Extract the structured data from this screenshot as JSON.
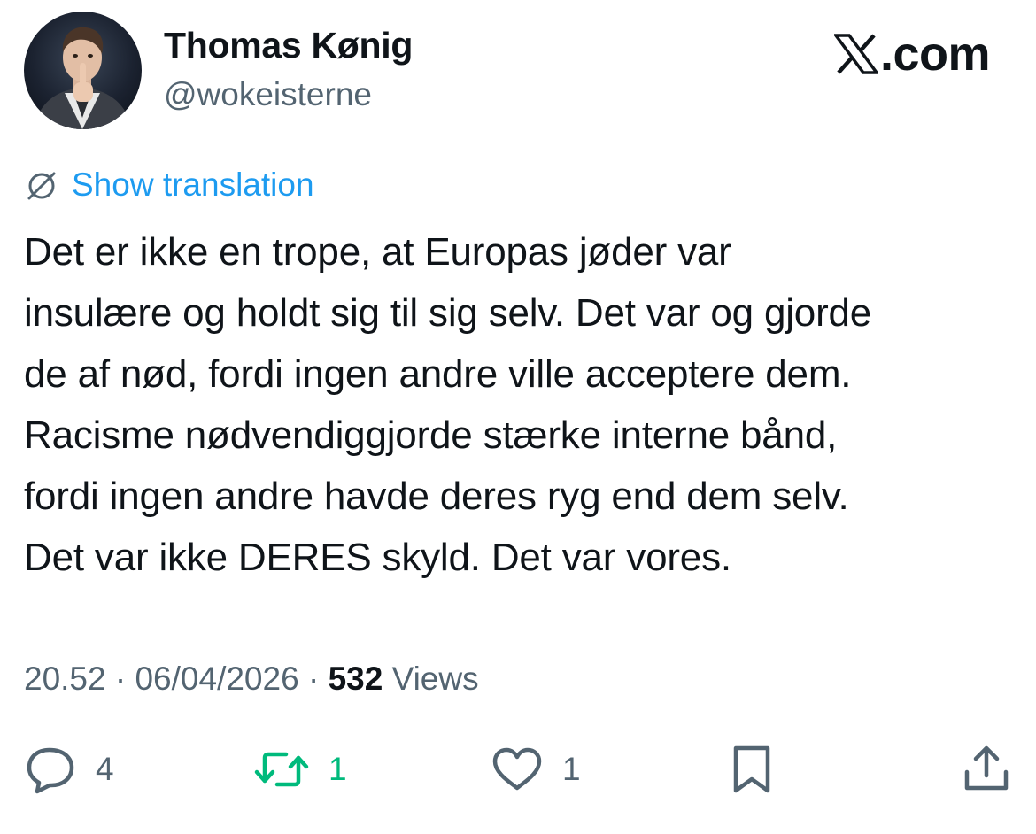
{
  "author": {
    "display_name": "Thomas Kønig",
    "handle": "@wokeisterne",
    "avatar_icon": "profile-photo"
  },
  "brand": {
    "icon": "x-logo-icon",
    "text": ".com"
  },
  "translate": {
    "icon": "globe-icon",
    "label": "Show translation",
    "color": "#1d9bf0"
  },
  "tweet": {
    "lines": [
      "Det er ikke en trope, at Europas jøder var",
      "insulære og holdt sig til sig selv. Det var og gjorde",
      "de af nød, fordi ingen andre ville acceptere dem.",
      "Racisme nødvendiggjorde stærke interne bånd,",
      "fordi ingen andre havde deres ryg end dem selv.",
      "Det var ikke DERES skyld. Det var vores."
    ]
  },
  "meta": {
    "time": "20.52",
    "separator": " · ",
    "date": "06/04/2026",
    "views_count": "532",
    "views_label": " Views"
  },
  "actions": {
    "reply": {
      "icon": "reply-icon",
      "count": "4"
    },
    "retweet": {
      "icon": "retweet-icon",
      "count": "1",
      "color": "#00ba7c"
    },
    "like": {
      "icon": "heart-icon",
      "count": "1"
    },
    "bookmark": {
      "icon": "bookmark-icon"
    },
    "share": {
      "icon": "share-icon"
    }
  },
  "colors": {
    "text": "#0f1419",
    "secondary": "#536471",
    "accent": "#1d9bf0",
    "retweet": "#00ba7c"
  }
}
